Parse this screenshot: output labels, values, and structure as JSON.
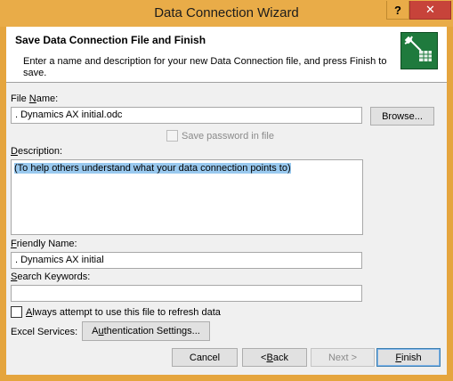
{
  "window": {
    "title": "Data Connection Wizard",
    "help_label": "?",
    "close_label": "✕"
  },
  "header": {
    "title": "Save Data Connection File and Finish",
    "description": "Enter a name and description for your new Data Connection file, and press Finish to save.",
    "icon": "data-connection-icon"
  },
  "file_name": {
    "label_pre": "File ",
    "label_key": "N",
    "label_post": "ame:",
    "value": ". Dynamics AX initial.odc",
    "browse_label": "Browse..."
  },
  "save_password": {
    "label": "Save password in file",
    "checked": false,
    "enabled": false
  },
  "description": {
    "label_key": "D",
    "label_post": "escription:",
    "value": "(To help others understand what your data connection points to)"
  },
  "friendly_name": {
    "label_key": "F",
    "label_post": "riendly Name:",
    "value": ". Dynamics AX initial"
  },
  "search_keywords": {
    "label_key": "S",
    "label_post": "earch Keywords:",
    "value": ""
  },
  "always_refresh": {
    "label_key": "A",
    "label_post": "lways attempt to use this file to refresh data",
    "checked": false
  },
  "excel_services": {
    "label": "Excel Services:",
    "auth_pre": "A",
    "auth_key": "u",
    "auth_post": "thentication Settings..."
  },
  "buttons": {
    "cancel": "Cancel",
    "back_pre": "< ",
    "back_key": "B",
    "back_post": "ack",
    "next": "Next >",
    "finish_key": "F",
    "finish_post": "inish"
  }
}
